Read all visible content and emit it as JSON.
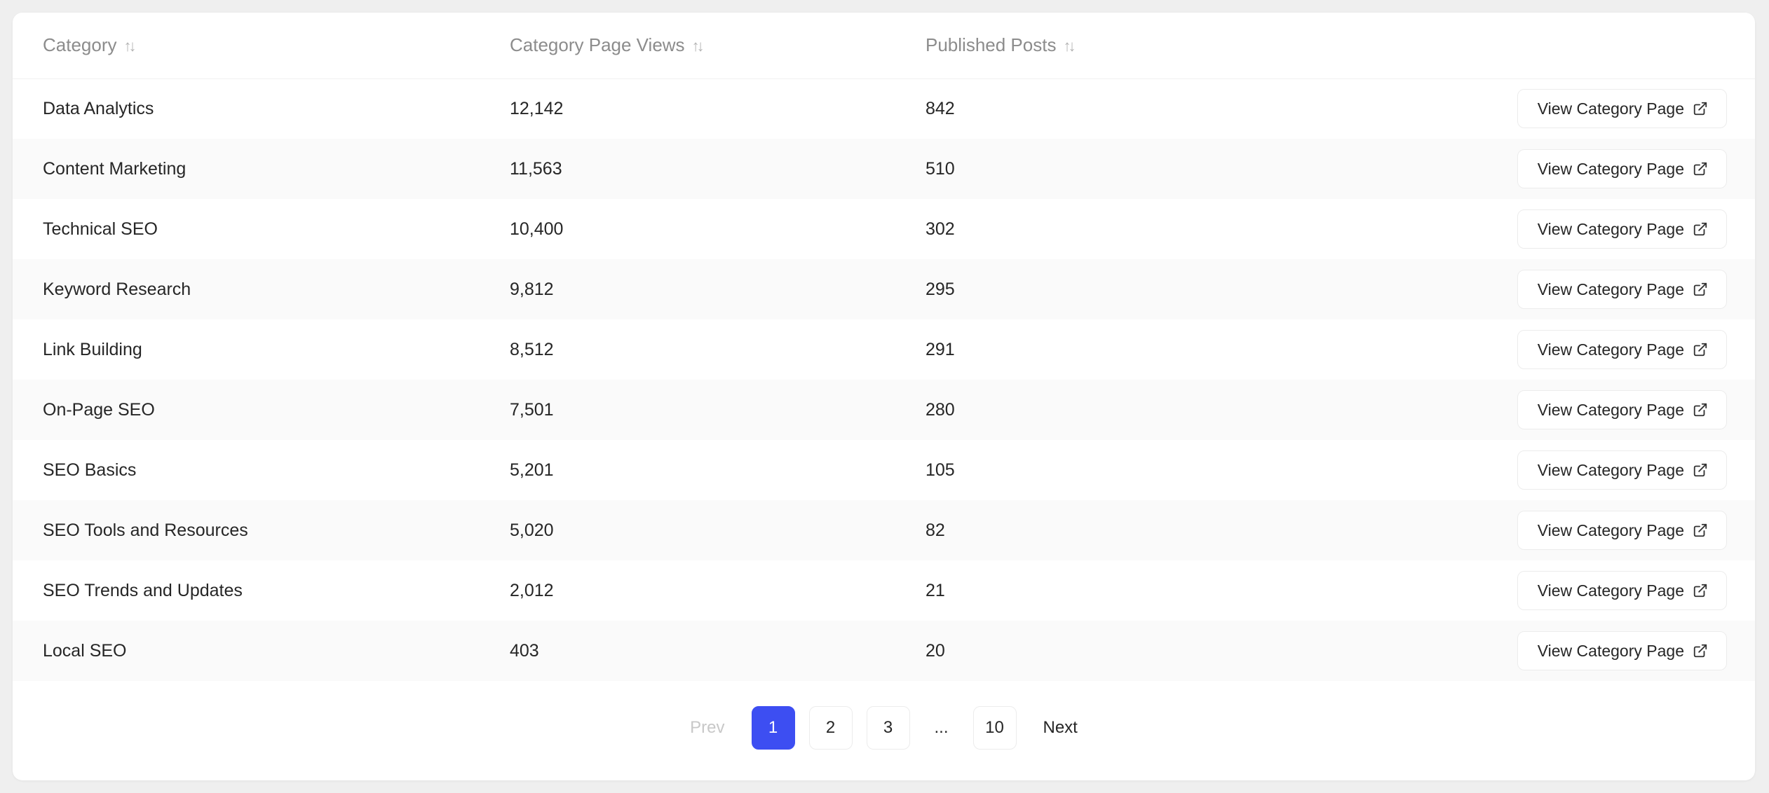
{
  "table": {
    "headers": {
      "category": "Category",
      "page_views": "Category Page Views",
      "published_posts": "Published Posts"
    },
    "action_label": "View Category Page",
    "rows": [
      {
        "category": "Data Analytics",
        "views": "12,142",
        "posts": "842"
      },
      {
        "category": "Content Marketing",
        "views": "11,563",
        "posts": "510"
      },
      {
        "category": "Technical SEO",
        "views": "10,400",
        "posts": "302"
      },
      {
        "category": "Keyword Research",
        "views": "9,812",
        "posts": "295"
      },
      {
        "category": "Link Building",
        "views": "8,512",
        "posts": "291"
      },
      {
        "category": "On-Page SEO",
        "views": "7,501",
        "posts": "280"
      },
      {
        "category": "SEO Basics",
        "views": "5,201",
        "posts": "105"
      },
      {
        "category": "SEO Tools and Resources",
        "views": "5,020",
        "posts": "82"
      },
      {
        "category": "SEO Trends and Updates",
        "views": "2,012",
        "posts": "21"
      },
      {
        "category": "Local SEO",
        "views": "403",
        "posts": "20"
      }
    ]
  },
  "pagination": {
    "prev_label": "Prev",
    "next_label": "Next",
    "pages": [
      "1",
      "2",
      "3"
    ],
    "ellipsis": "...",
    "last_page": "10",
    "current_page": "1"
  },
  "colors": {
    "accent": "#3d4ef2",
    "background": "#efefef",
    "card": "#ffffff"
  },
  "icons": {
    "sort": "sort-icon",
    "external_link": "external-link-icon"
  }
}
